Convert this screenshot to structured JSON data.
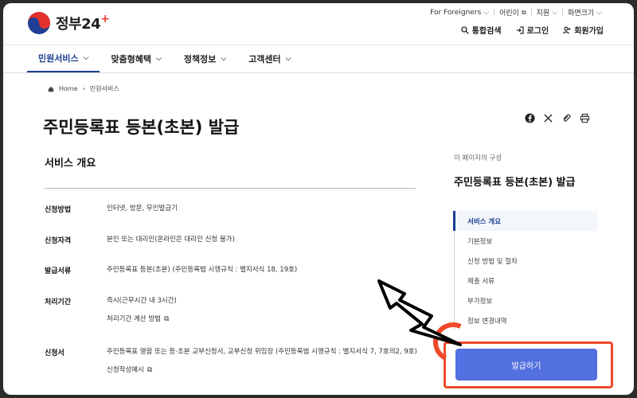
{
  "header": {
    "logo_text": "정부",
    "logo_num": "24",
    "util_top": [
      "For Foreigners",
      "어린이",
      "지원",
      "화면크기"
    ],
    "util_main": [
      "통합검색",
      "로그인",
      "회원가입"
    ]
  },
  "nav": {
    "items": [
      "민원서비스",
      "맞춤형혜택",
      "정책정보",
      "고객센터"
    ]
  },
  "breadcrumb": [
    "Home",
    "민원서비스"
  ],
  "page": {
    "title": "주민등록표 등본(초본) 발급",
    "section_title": "서비스 개요"
  },
  "info": [
    {
      "label": "신청방법",
      "value": "인터넷, 방문, 무인발급기"
    },
    {
      "label": "신청자격",
      "value": "본인 또는 대리인(온라인은 대리인 신청 불가)"
    },
    {
      "label": "발급서류",
      "value": "주민등록표 등본(초본) (주민등록법 시행규칙 : 별지서식 18, 19호)"
    },
    {
      "label": "처리기간",
      "value": "즉시(근무시간 내 3시간)",
      "sub": "처리기간 계산 방법"
    },
    {
      "label": "신청서",
      "value": "주민등록표 열람 또는 등·초본 교부신청서, 교부신청 위임장 (주민등록법 시행규칙 : 별지서식 7, 7호의2, 9호)",
      "sub": "신청작성예시"
    }
  ],
  "toc": {
    "head": "이 페이지의 구성",
    "title": "주민등록표 등본(초본) 발급",
    "items": [
      "서비스 개요",
      "기본정보",
      "신청 방법 및 절차",
      "제출 서류",
      "부가정보",
      "정보 변경내역"
    ]
  },
  "issue_button": "발급하기",
  "colors": {
    "accent": "#5270e0",
    "highlight": "#f04a2a",
    "nav_active": "#1b3d8f"
  }
}
